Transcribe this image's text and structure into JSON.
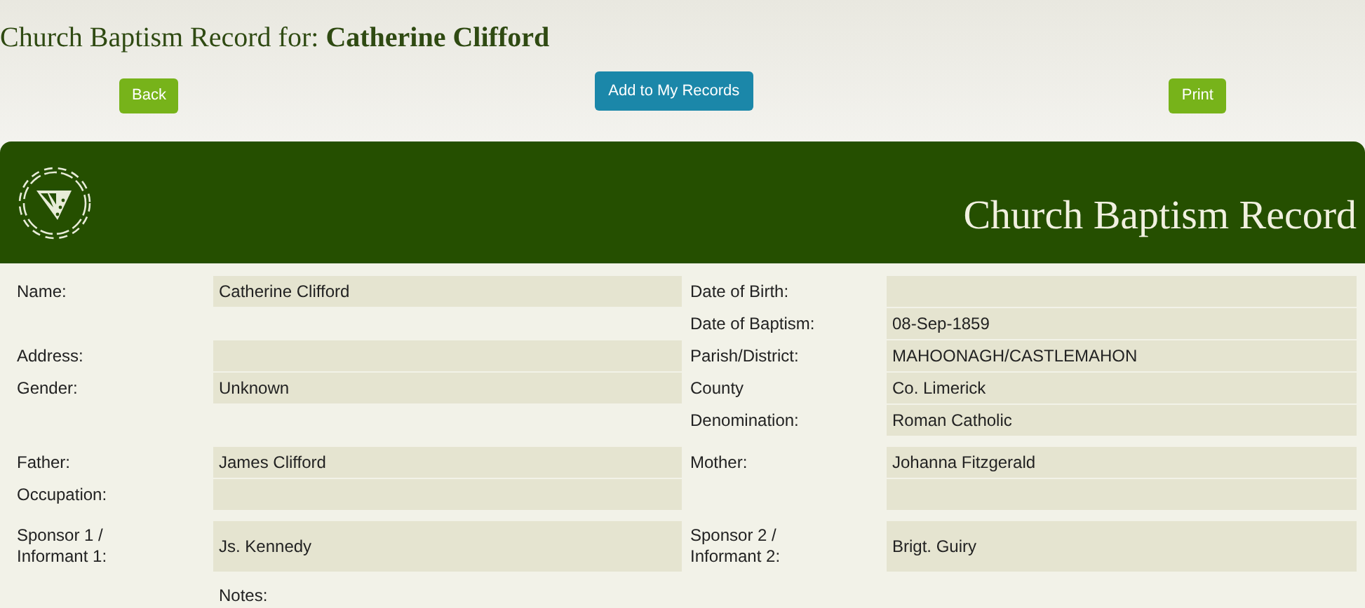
{
  "page_title": "Church Baptism Record for: **Catherine Clifford**",
  "buttons": [
    {
      "label": "Back",
      "kind": "green"
    },
    {
      "label": "Add to My Records",
      "kind": "blue"
    },
    {
      "label": "Print",
      "kind": "green"
    }
  ],
  "record": {
    "title": "Church Baptism Record",
    "sections": [
      {
        "left": [
          {
            "kind": "field",
            "label": "Name:",
            "value": "Catherine Clifford"
          },
          {
            "kind": "spacer"
          },
          {
            "kind": "field",
            "label": "Address:"
          },
          {
            "kind": "field",
            "label": "Gender:",
            "value": "Unknown"
          },
          {
            "kind": "spacer"
          }
        ],
        "right": [
          {
            "kind": "field",
            "label": "Date of Birth:"
          },
          {
            "kind": "field",
            "label": "Date of Baptism:",
            "value": "08-Sep-1859"
          },
          {
            "kind": "field",
            "label": "Parish/District:",
            "value": "MAHOONAGH/CASTLEMAHON"
          },
          {
            "kind": "field",
            "label": "County",
            "value": "Co. Limerick"
          },
          {
            "kind": "field",
            "label": "Denomination:",
            "value": "Roman Catholic"
          }
        ]
      },
      {
        "left": [
          {
            "kind": "field",
            "label": "Father:",
            "value": "James Clifford"
          },
          {
            "kind": "field",
            "label": "Occupation:"
          }
        ],
        "right": [
          {
            "kind": "field",
            "label": "Mother:",
            "value": "Johanna Fitzgerald"
          },
          {
            "kind": "field"
          }
        ]
      },
      {
        "tall": true,
        "left": [
          {
            "kind": "field",
            "label": "Sponsor 1 / Informant 1:",
            "value": "Js. Kennedy"
          }
        ],
        "right": [
          {
            "kind": "field",
            "label": "Sponsor 2 / Informant 2:",
            "value": "Brigt. Guiry"
          }
        ]
      }
    ],
    "notes_label": "Notes:"
  }
}
